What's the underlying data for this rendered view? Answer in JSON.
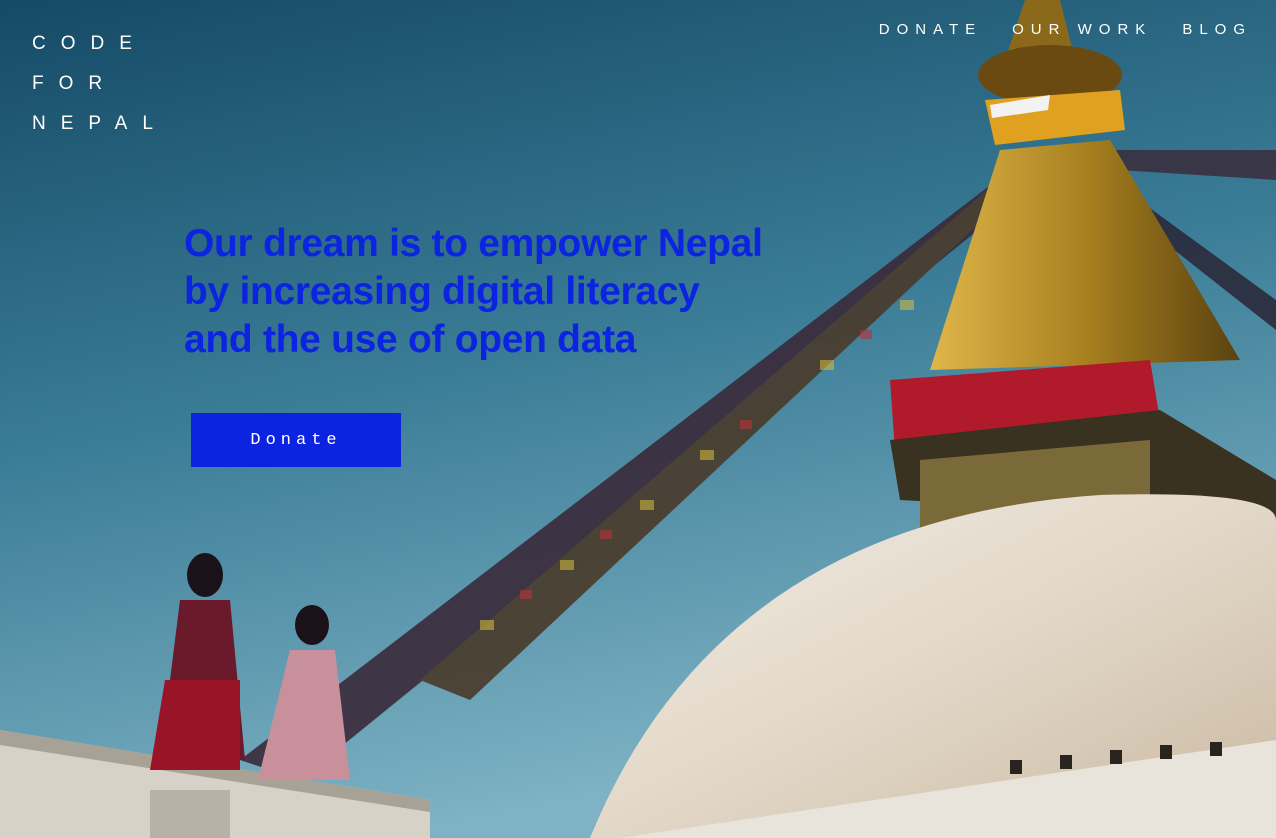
{
  "logo": {
    "line1": "CODE",
    "line2": "FOR",
    "line3": "NEPAL"
  },
  "nav": {
    "items": [
      {
        "label": "DONATE"
      },
      {
        "label": "OUR WORK"
      },
      {
        "label": "BLOG"
      }
    ]
  },
  "hero": {
    "headline_lines": [
      "Our dream is to empower Nepal",
      "by increasing digital literacy",
      "and the use of open data"
    ],
    "cta_label": "Donate"
  },
  "colors": {
    "accent": "#0c24e0",
    "nav_text": "#ffffff"
  }
}
